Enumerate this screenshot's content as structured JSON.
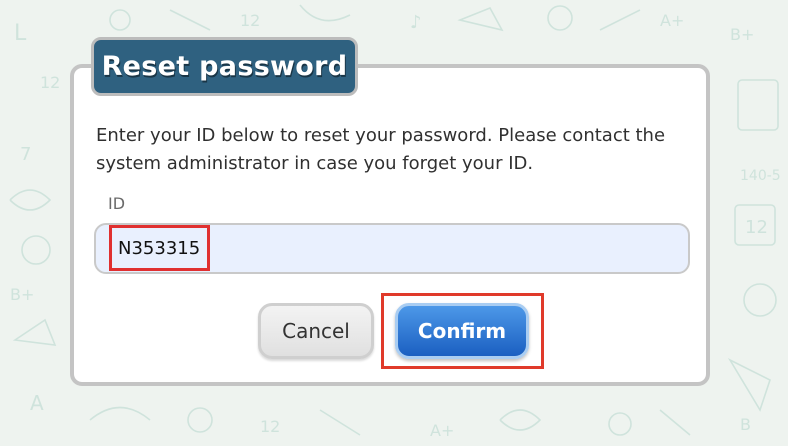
{
  "dialog": {
    "title": "Reset password",
    "message": "Enter your ID below to reset your password. Please contact the system administrator in case you forget your ID.",
    "id_label": "ID",
    "id_value": "N353315",
    "cancel_label": "Cancel",
    "confirm_label": "Confirm"
  },
  "colors": {
    "title_bg": "#2f6180",
    "confirm_bg": "#1b5fc1",
    "input_bg": "#e9f0fe",
    "highlight": "#e03030"
  }
}
